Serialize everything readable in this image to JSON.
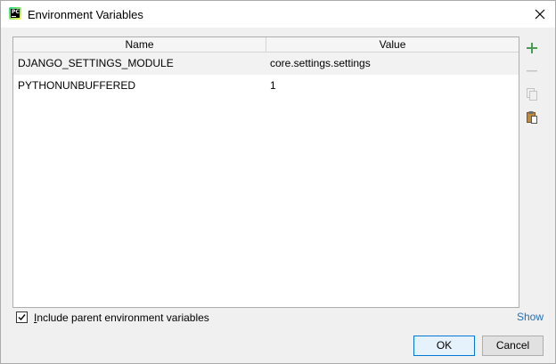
{
  "window": {
    "title": "Environment Variables",
    "app_icon": "pycharm-icon"
  },
  "table": {
    "headers": {
      "name": "Name",
      "value": "Value"
    },
    "rows": [
      {
        "name": "DJANGO_SETTINGS_MODULE",
        "value": "core.settings.settings"
      },
      {
        "name": "PYTHONUNBUFFERED",
        "value": "1"
      }
    ]
  },
  "toolbar": {
    "add_icon": "plus-icon",
    "remove_icon": "minus-icon",
    "copy_icon": "copy-icon",
    "paste_icon": "paste-icon"
  },
  "footer": {
    "include_parent_label_first": "I",
    "include_parent_label_rest": "nclude parent environment variables",
    "include_parent_checked": true,
    "show_link": "Show",
    "ok_label": "OK",
    "cancel_label": "Cancel"
  },
  "colors": {
    "accent_green": "#499c54",
    "link_blue": "#2470b3",
    "ok_border": "#0078d7"
  }
}
